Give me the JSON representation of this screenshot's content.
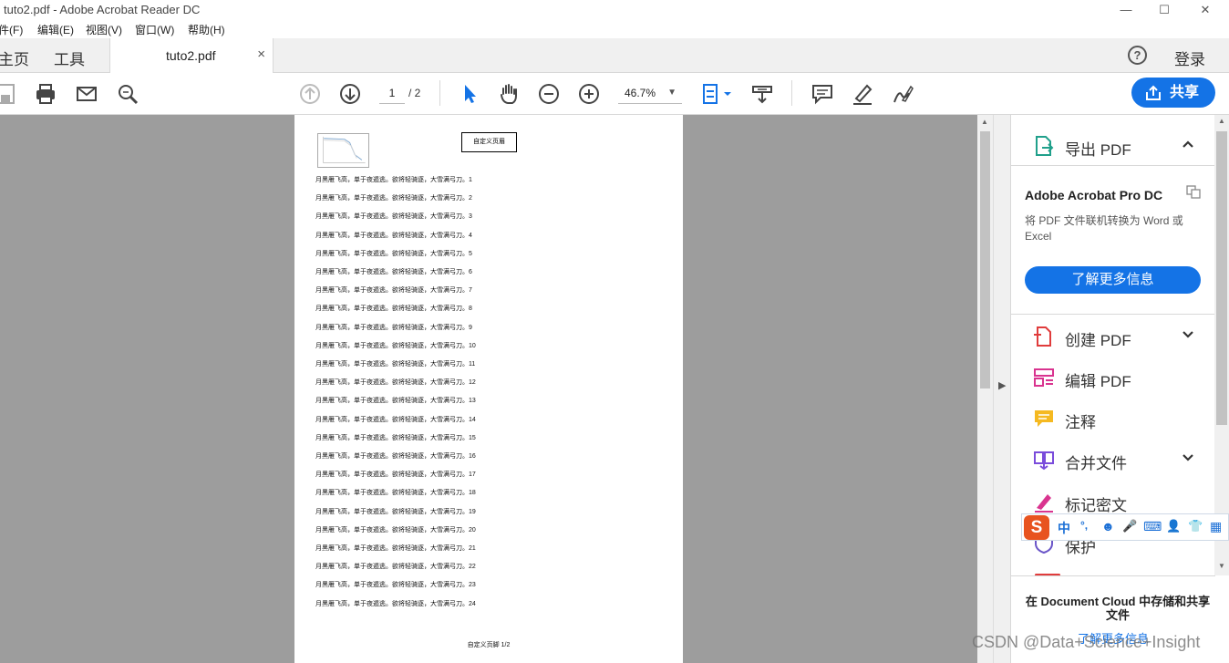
{
  "window": {
    "title": "tuto2.pdf - Adobe Acrobat Reader DC",
    "min": "—",
    "max": "☐",
    "close": "✕"
  },
  "menu": [
    "件(F)",
    "编辑(E)",
    "视图(V)",
    "窗口(W)",
    "帮助(H)"
  ],
  "tabs": {
    "home": "主页",
    "tools": "工具",
    "document": "tuto2.pdf",
    "close": "×",
    "help": "?",
    "login": "登录"
  },
  "toolbar": {
    "page_current": "1",
    "page_total": "/ 2",
    "zoom": "46.7%",
    "zoom_arrow": "▼",
    "share": "共享"
  },
  "page": {
    "header_box": "自定义页眉",
    "line_text": "月黑雁飞高，单于夜遁逃。欲将轻骑逐，大雪满弓刀。",
    "lines": [
      "1",
      "2",
      "3",
      "4",
      "5",
      "6",
      "7",
      "8",
      "9",
      "10",
      "11",
      "12",
      "13",
      "14",
      "15",
      "16",
      "17",
      "18",
      "19",
      "20",
      "21",
      "22",
      "23",
      "24"
    ],
    "footer": "自定义页脚 1/2"
  },
  "right_panel": {
    "export": "导出 PDF",
    "promo_title": "Adobe Acrobat Pro DC",
    "promo_desc": "将 PDF 文件联机转换为 Word 或 Excel",
    "promo_btn": "了解更多信息",
    "create": "创建 PDF",
    "edit": "编辑 PDF",
    "comment": "注释",
    "combine": "合并文件",
    "redact": "标记密文",
    "protect": "保护",
    "cloud_title": "在 Document Cloud 中存储和共享文件",
    "cloud_link": "了解更多信息"
  },
  "ime": {
    "logo": "S",
    "lang": "中",
    "punct": "°,",
    "emoji": "☻",
    "mic": "🎤",
    "keyboard": "⌨",
    "user": "👤",
    "skin": "👕",
    "apps": "▦"
  },
  "watermark": "CSDN @Data+Science+Insight",
  "colors": {
    "accent": "#1473e6",
    "viewer_bg": "#9d9d9d",
    "ime_logo": "#e8531f"
  }
}
